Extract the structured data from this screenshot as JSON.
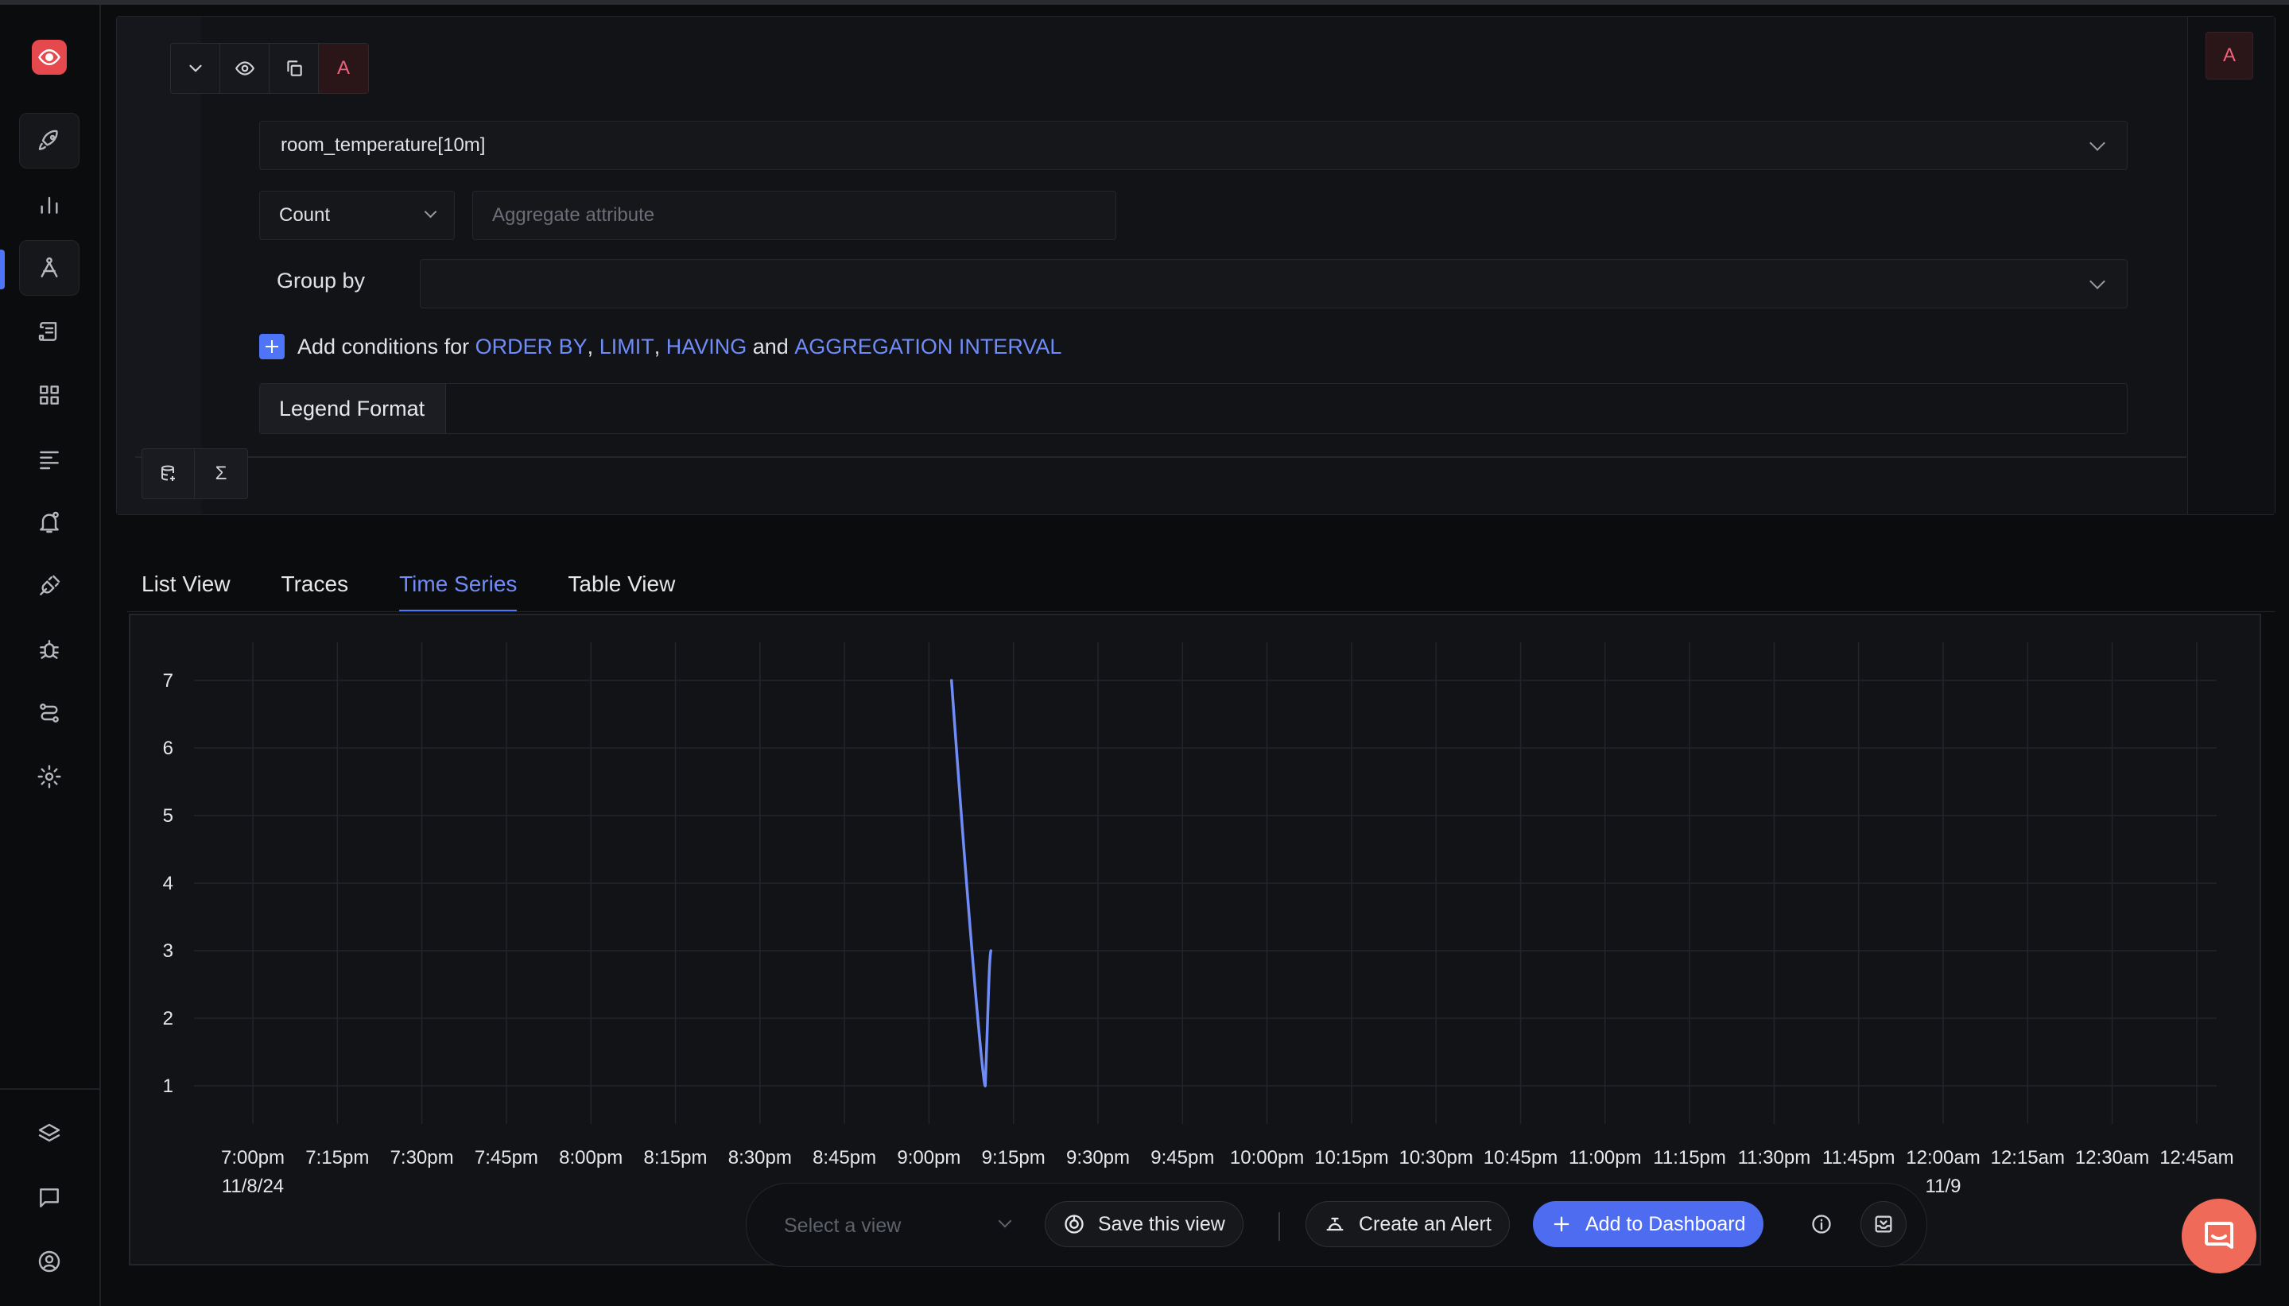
{
  "colors": {
    "accent": "#4e74f8",
    "series": "#6f8cf8",
    "brand": "#e5484d",
    "danger_text": "#f0627a"
  },
  "sidebar": {
    "logo_icon": "eye-icon",
    "items": [
      {
        "name": "get-started",
        "icon": "rocket-icon"
      },
      {
        "name": "dashboards-metrics",
        "icon": "bar-chart-icon"
      },
      {
        "name": "explorer",
        "icon": "compass-icon",
        "active": true
      },
      {
        "name": "logs",
        "icon": "scroll-icon"
      },
      {
        "name": "dashboards",
        "icon": "grid-icon"
      },
      {
        "name": "pipelines",
        "icon": "lines-icon"
      },
      {
        "name": "alerts",
        "icon": "bell-icon"
      },
      {
        "name": "integrations",
        "icon": "plug-icon"
      },
      {
        "name": "exceptions",
        "icon": "bug-icon"
      },
      {
        "name": "service-map",
        "icon": "route-icon"
      },
      {
        "name": "settings",
        "icon": "gear-icon"
      }
    ],
    "bottom_items": [
      {
        "name": "layers",
        "icon": "layers-icon"
      },
      {
        "name": "feedback",
        "icon": "message-icon"
      },
      {
        "name": "account",
        "icon": "user-circle-icon"
      }
    ]
  },
  "query": {
    "letter": "A",
    "side_letter": "A",
    "metric_value": "room_temperature[10m]",
    "aggregate_operator": "Count",
    "aggregate_attribute_placeholder": "Aggregate attribute",
    "group_by_label": "Group by",
    "add_conditions": {
      "prefix": "Add conditions for ",
      "order_by": "ORDER BY",
      "comma1": ", ",
      "limit": "LIMIT",
      "comma2": ", ",
      "having": "HAVING",
      "and": " and ",
      "interval": "AGGREGATION INTERVAL"
    },
    "legend_format_label": "Legend Format",
    "sigma": "Σ"
  },
  "tabs": [
    {
      "label": "List View",
      "active": false
    },
    {
      "label": "Traces",
      "active": false
    },
    {
      "label": "Time Series",
      "active": true
    },
    {
      "label": "Table View",
      "active": false
    }
  ],
  "chart_data": {
    "type": "line",
    "title": "",
    "xlabel": "",
    "ylabel": "",
    "y_ticks": [
      1,
      2,
      3,
      4,
      5,
      6,
      7
    ],
    "ylim": [
      1,
      7
    ],
    "x_ticks": [
      "7:00pm",
      "7:15pm",
      "7:30pm",
      "7:45pm",
      "8:00pm",
      "8:15pm",
      "8:30pm",
      "8:45pm",
      "9:00pm",
      "9:15pm",
      "9:30pm",
      "9:45pm",
      "10:00pm",
      "10:15pm",
      "10:30pm",
      "10:45pm",
      "11:00pm",
      "11:15pm",
      "11:30pm",
      "11:45pm",
      "12:00am",
      "12:15am",
      "12:30am",
      "12:45am"
    ],
    "x_sublabels": [
      {
        "tick": "7:00pm",
        "text": "11/8/24"
      },
      {
        "tick": "12:00am",
        "text": "11/9"
      }
    ],
    "grid": true,
    "series": [
      {
        "points": [
          {
            "x": "9:04pm",
            "y": 7
          },
          {
            "x": "9:10pm",
            "y": 1
          },
          {
            "x": "9:11pm",
            "y": 3
          }
        ]
      }
    ]
  },
  "actions": {
    "select_view_placeholder": "Select a view",
    "save_view": "Save this view",
    "create_alert": "Create an Alert",
    "add_to_dashboard": "Add to Dashboard"
  }
}
